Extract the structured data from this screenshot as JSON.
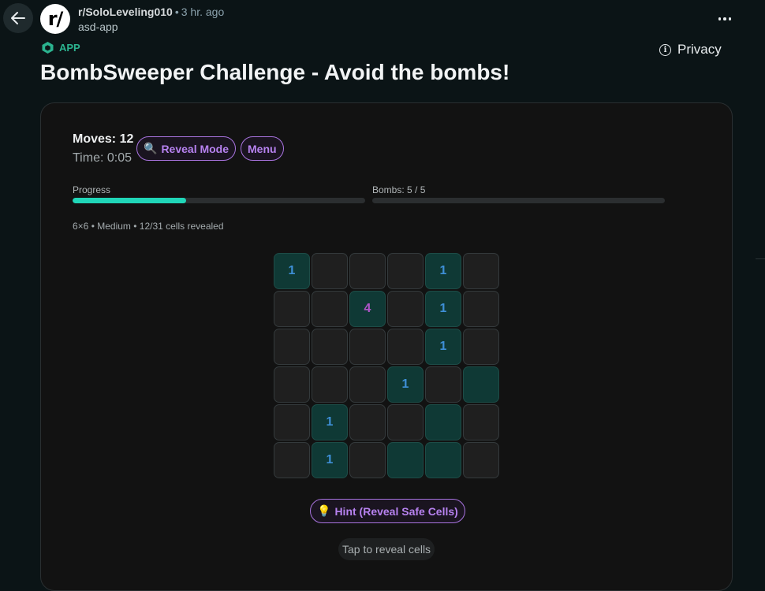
{
  "header": {
    "subreddit": "r/SoloLeveling010",
    "separator": "•",
    "time_ago": "3 hr. ago",
    "author": "asd-app",
    "avatar_text": "r/"
  },
  "post": {
    "app_tag": "APP",
    "privacy_label": "Privacy",
    "title": "BombSweeper Challenge - Avoid the bombs!"
  },
  "game": {
    "moves": "Moves: 12",
    "time": "Time: 0:05",
    "reveal_mode_label": "Reveal Mode",
    "reveal_mode_icon": "🔍",
    "menu_label": "Menu",
    "progress_label": "Progress",
    "progress_fraction": 0.387,
    "bombs_label": "Bombs: 5 / 5",
    "bombs_fill_fraction": 0,
    "board_info": "6×6 • Medium • 12/31 cells revealed",
    "hint_label": "Hint (Reveal Safe Cells)",
    "hint_icon": "💡",
    "tap_text": "Tap to reveal cells",
    "number_colors": {
      "1": "#3e8fd6",
      "4": "#b054c8"
    },
    "grid": [
      [
        {
          "r": true,
          "v": "1"
        },
        {
          "r": false,
          "v": ""
        },
        {
          "r": false,
          "v": ""
        },
        {
          "r": false,
          "v": ""
        },
        {
          "r": true,
          "v": "1"
        },
        {
          "r": false,
          "v": ""
        }
      ],
      [
        {
          "r": false,
          "v": ""
        },
        {
          "r": false,
          "v": ""
        },
        {
          "r": true,
          "v": "4"
        },
        {
          "r": false,
          "v": ""
        },
        {
          "r": true,
          "v": "1"
        },
        {
          "r": false,
          "v": ""
        }
      ],
      [
        {
          "r": false,
          "v": ""
        },
        {
          "r": false,
          "v": ""
        },
        {
          "r": false,
          "v": ""
        },
        {
          "r": false,
          "v": ""
        },
        {
          "r": true,
          "v": "1"
        },
        {
          "r": false,
          "v": ""
        }
      ],
      [
        {
          "r": false,
          "v": ""
        },
        {
          "r": false,
          "v": ""
        },
        {
          "r": false,
          "v": ""
        },
        {
          "r": true,
          "v": "1"
        },
        {
          "r": false,
          "v": ""
        },
        {
          "r": true,
          "v": ""
        }
      ],
      [
        {
          "r": false,
          "v": ""
        },
        {
          "r": true,
          "v": "1"
        },
        {
          "r": false,
          "v": ""
        },
        {
          "r": false,
          "v": ""
        },
        {
          "r": true,
          "v": ""
        },
        {
          "r": false,
          "v": ""
        }
      ],
      [
        {
          "r": false,
          "v": ""
        },
        {
          "r": true,
          "v": "1"
        },
        {
          "r": false,
          "v": ""
        },
        {
          "r": true,
          "v": ""
        },
        {
          "r": true,
          "v": ""
        },
        {
          "r": false,
          "v": ""
        }
      ]
    ]
  }
}
